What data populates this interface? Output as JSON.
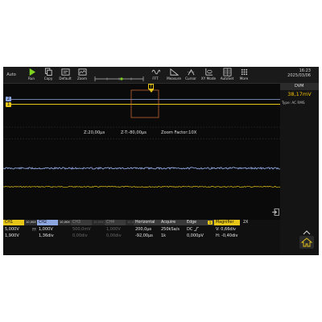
{
  "toolbar": {
    "auto": "Auto",
    "run": "Run",
    "copy": "Copy",
    "default": "Default",
    "zoom": "Zoom",
    "fft": "FFT",
    "measure": "Measure",
    "cursor": "Cursor",
    "xy_mode": "XY Mode",
    "autoset": "AutoSet",
    "more": "More"
  },
  "datetime": {
    "time": "16:23",
    "date": "2025/03/06"
  },
  "trigger_marker": "T",
  "dvm": {
    "title": "DVM",
    "value": "38,17mV",
    "type": "Type: AC RMS"
  },
  "zoom_info": {
    "z_time": "Z:20,00µs",
    "z_t": "Z-T:-80,00µs",
    "factor": "Zoom Factor:10X"
  },
  "channel_markers": {
    "ch2": "2",
    "ch1": "1"
  },
  "status": {
    "ch1": {
      "label": "CH1",
      "probe": "10,00X",
      "scale": "5,000V",
      "offset": "1,900V"
    },
    "ch2": {
      "label": "CH2",
      "probe": "10,00X",
      "scale": "1,000V",
      "offset": "1,36div"
    },
    "ch3": {
      "label": "CH3",
      "probe": "10,00X",
      "scale": "500,0mV",
      "offset": "0,00div"
    },
    "ch4": {
      "label": "CH4",
      "probe": "10,00X",
      "scale": "1,000V",
      "offset": "0,00div"
    },
    "horizontal": {
      "label": "Horizontal",
      "timebase": "200,0µs",
      "position": "-92,00µs"
    },
    "acquire": {
      "label": "Acquire",
      "rate": "250kSa/s",
      "depth": "1k"
    },
    "edge": {
      "label": "Edge",
      "source": "1",
      "coupling": "DC",
      "level": "0,000pV"
    },
    "magnifier": {
      "label": "Magnifier",
      "factor": "2X",
      "v": "V: 0,66div",
      "h": "H: -0,40div"
    }
  },
  "colors": {
    "ch1": "#e6c619",
    "ch2": "#8ea6e0",
    "ch3": "#666666",
    "ch4": "#666666",
    "edge_badge": "#e6c619",
    "toolbar_icon": "#d8d8d8",
    "accent": "#f2c200"
  }
}
